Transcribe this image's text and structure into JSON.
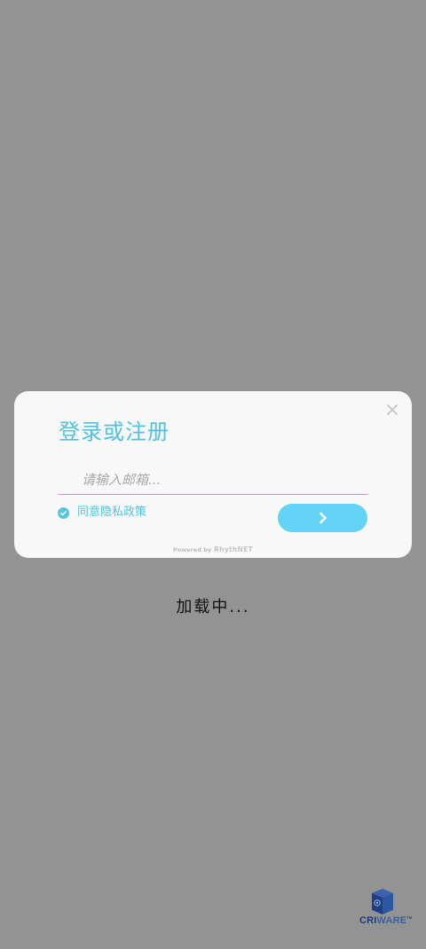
{
  "dialog": {
    "title": "登录或注册",
    "email": {
      "value": "",
      "placeholder": "请输入邮箱..."
    },
    "agree_label": "同意隐私政策",
    "agree_checked": true,
    "submit_icon": "chevron-right-icon",
    "close_icon": "close-icon",
    "powered_by": "Powered by",
    "powered_brand": "RhythNET"
  },
  "loading_text": "加载中...",
  "logo": {
    "bold": "CRI",
    "rest": "WARE",
    "tm": "TM"
  },
  "colors": {
    "background": "#939393",
    "dialog_bg": "#f8f8f8",
    "accent": "#4ec3df",
    "button": "#63d3f6"
  }
}
